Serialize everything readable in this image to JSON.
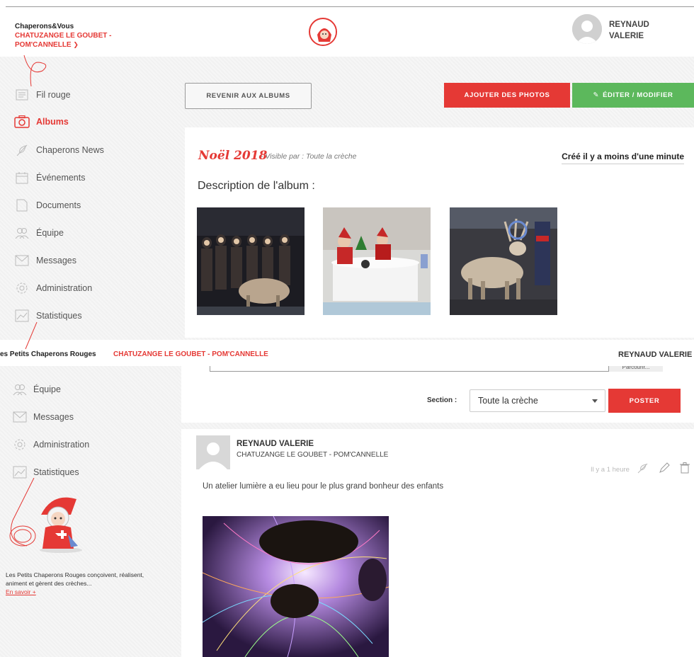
{
  "header": {
    "app_name": "Chaperons&Vous",
    "site_name": "CHATUZANGE LE GOUBET - POM'CANNELLE",
    "user_first": "REYNAUD",
    "user_last": "VALERIE"
  },
  "sidebar": {
    "items": [
      {
        "label": "Fil rouge",
        "icon": "newspaper-icon"
      },
      {
        "label": "Albums",
        "icon": "camera-icon"
      },
      {
        "label": "Chaperons News",
        "icon": "feather-icon"
      },
      {
        "label": "Événements",
        "icon": "calendar-icon"
      },
      {
        "label": "Documents",
        "icon": "document-icon"
      },
      {
        "label": "Équipe",
        "icon": "team-icon"
      },
      {
        "label": "Messages",
        "icon": "envelope-icon"
      },
      {
        "label": "Administration",
        "icon": "settings-icon"
      },
      {
        "label": "Statistiques",
        "icon": "chart-icon"
      }
    ],
    "active": "Albums"
  },
  "toolbar": {
    "back_label": "REVENIR AUX ALBUMS",
    "add_label": "AJOUTER DES PHOTOS",
    "edit_label": "ÉDITER / MODIFIER"
  },
  "album": {
    "title": "Noël 2018",
    "visibility": "- Visible par : Toute la crèche",
    "created": "Créé il y a moins d'une minute",
    "description_label": "Description de l'album :",
    "photos": [
      "group-photo",
      "santa-photo",
      "reindeer-photo"
    ]
  },
  "second_header": {
    "brand": "es Petits Chaperons Rouges",
    "site": "CHATUZANGE LE GOUBET - POM'CANNELLE",
    "user": "REYNAUD VALERIE"
  },
  "sidebar2": {
    "items": [
      {
        "label": "Équipe",
        "icon": "team-icon"
      },
      {
        "label": "Messages",
        "icon": "envelope-icon"
      },
      {
        "label": "Administration",
        "icon": "settings-icon"
      },
      {
        "label": "Statistiques",
        "icon": "chart-icon"
      }
    ],
    "promo_text": "Les Petits Chaperons Rouges conçoivent, réalisent, animent et gèrent des crèches...",
    "promo_link": "En savoir +"
  },
  "post_form": {
    "browse_label": "Parcourir...",
    "section_label": "Section :",
    "section_value": "Toute la crèche",
    "post_label": "POSTER"
  },
  "post": {
    "author": "REYNAUD VALERIE",
    "site": "CHATUZANGE LE GOUBET - POM'CANNELLE",
    "time": "Il y a 1 heure",
    "text": "Un atelier lumière a eu lieu pour le plus grand bonheur des enfants"
  },
  "colors": {
    "accent": "#e53935",
    "success": "#5cb85c"
  }
}
